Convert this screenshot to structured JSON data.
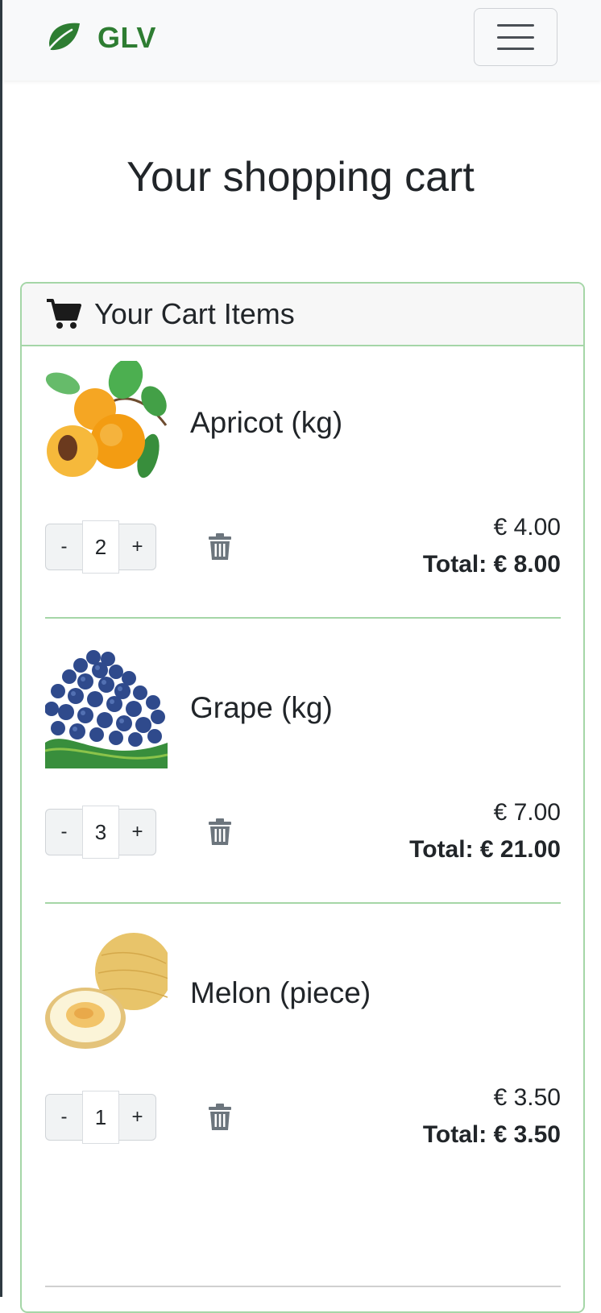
{
  "navbar": {
    "brand": "GLV",
    "brand_icon": "leaf-icon",
    "menu_icon": "hamburger-menu-icon",
    "brand_color": "#2e7d32"
  },
  "page": {
    "title": "Your shopping cart"
  },
  "cart": {
    "header_title": "Your Cart Items",
    "header_icon": "shopping-cart-icon",
    "accent_color": "#a5d6a7",
    "items": [
      {
        "name": "Apricot (kg)",
        "quantity": "2",
        "price": "€ 4.00",
        "total": "Total: € 8.00",
        "image": "apricot-image"
      },
      {
        "name": "Grape (kg)",
        "quantity": "3",
        "price": "€ 7.00",
        "total": "Total: € 21.00",
        "image": "grape-image"
      },
      {
        "name": "Melon (piece)",
        "quantity": "1",
        "price": "€ 3.50",
        "total": "Total: € 3.50",
        "image": "melon-image"
      }
    ],
    "minus_label": "-",
    "plus_label": "+",
    "delete_icon": "trash-icon"
  }
}
